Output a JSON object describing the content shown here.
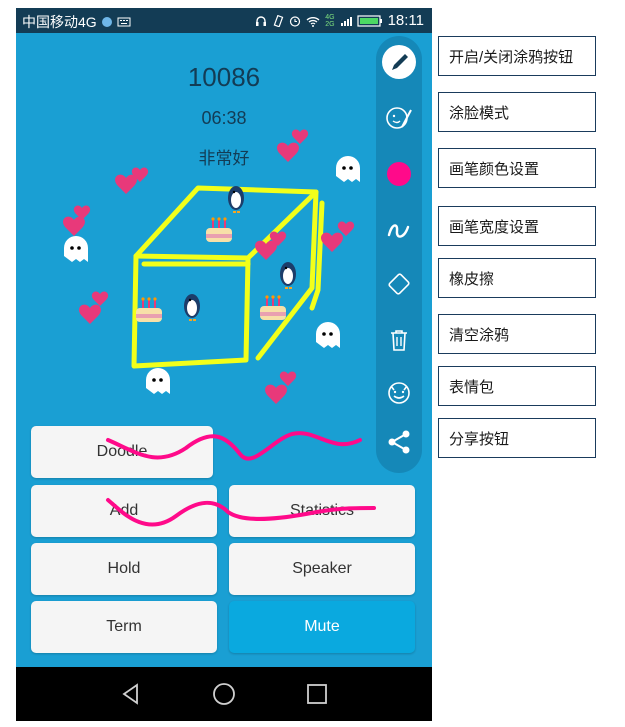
{
  "status_bar": {
    "carrier": "中国移动4G",
    "network_type": "4G",
    "network_type_2": "2G",
    "time": "18:11"
  },
  "call": {
    "number": "10086",
    "duration": "06:38",
    "quality": "非常好"
  },
  "buttons": {
    "doodle": "Doodle",
    "add": "Add",
    "statistics": "Statistics",
    "hold": "Hold",
    "speaker": "Speaker",
    "term": "Term",
    "mute": "Mute"
  },
  "toolbar_icons": [
    "pen-toggle-icon",
    "face-paint-icon",
    "color-dot-icon",
    "stroke-width-icon",
    "eraser-icon",
    "trash-icon",
    "emoji-icon",
    "share-icon"
  ],
  "legend": {
    "toggle": "开启/关闭涂鸦按钮",
    "face_mode": "涂脸模式",
    "pen_color": "画笔颜色设置",
    "pen_width": "画笔宽度设置",
    "eraser": "橡皮擦",
    "clear": "清空涂鸦",
    "emoji": "表情包",
    "share": "分享按钮"
  },
  "colors": {
    "background": "#1a9fd3",
    "status_bar": "#133c55",
    "toolbar": "#1588b8",
    "pen": "#ff0a8a",
    "doodle_yellow": "#f2ff1a",
    "mute_active": "#0aa9df"
  }
}
